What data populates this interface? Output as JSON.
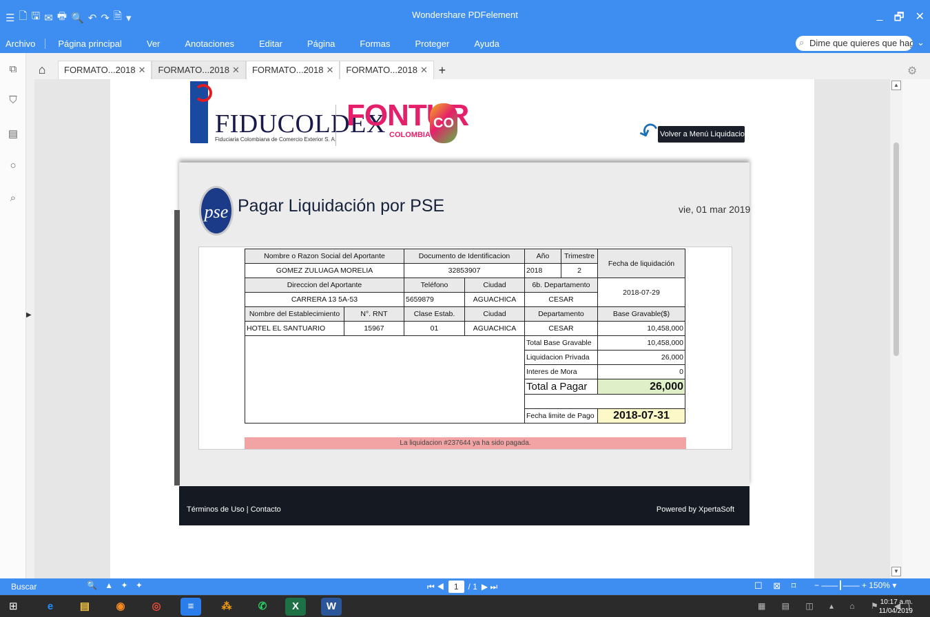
{
  "window": {
    "title": "Wondershare PDFelement",
    "quick_access": [
      "☰",
      "🗋",
      "🖫",
      "✉",
      "🖶",
      "🔍",
      "↶",
      "↷",
      "🗎",
      "▾"
    ],
    "controls": {
      "minimize": "_",
      "restore": "🗗",
      "close": "✕"
    }
  },
  "menu": {
    "items": [
      "Archivo",
      "Página principal",
      "Ver",
      "Anotaciones",
      "Editar",
      "Página",
      "Formas",
      "Proteger",
      "Ayuda"
    ],
    "search_placeholder": "Dime que quieres que hag",
    "search_icon": "⌕",
    "expand_icon": "⌄"
  },
  "tabs": [
    {
      "label": "FORMATO...2018",
      "close": "✕"
    },
    {
      "label": "FORMATO...2018",
      "close": "✕"
    },
    {
      "label": "FORMATO...2018",
      "close": "✕"
    },
    {
      "label": "FORMATO...2018",
      "close": "✕"
    }
  ],
  "tab_add": "+",
  "home_icon": "⌂",
  "document": {
    "fiduciaria_name": "FIDUCOLDEX",
    "fiduciaria_sub": "Fiduciaria Colombiana de Comercio Exterior S. A.",
    "fontur": "FONTUR",
    "fontur_country": "COLOMBIA",
    "fontur_badge": "CO",
    "back_button": "Volver a Menú Liquidaciones",
    "pse_logo": "pse",
    "pse_title": "Pagar Liquidación por PSE",
    "date": "vie, 01 mar 2019",
    "headers": {
      "razon_social": "Nombre o Razon Social del Aportante",
      "documento": "Documento de Identificacion",
      "anio": "Año",
      "trimestre": "Trimestre",
      "fecha_liq": "Fecha de liquidación",
      "direccion": "Direccion del Aportante",
      "telefono": "Teléfono",
      "ciudad": "Ciudad",
      "departamento_6b": "6b. Departamento",
      "establecimiento": "Nombre del Establecimiento",
      "rnt": "N°. RNT",
      "clase": "Clase Estab.",
      "ciudad2": "Ciudad",
      "departamento": "Departamento",
      "base": "Base Gravable($)"
    },
    "values": {
      "razon_social": "GOMEZ ZULUAGA MORELIA",
      "documento": "32853907",
      "anio": "2018",
      "trimestre": "2",
      "fecha_liq": "2018-07-29",
      "direccion": "CARRERA 13 5A-53",
      "telefono": "5659879",
      "ciudad": "AGUACHICA",
      "departamento_6b": "CESAR",
      "establecimiento": "HOTEL EL SANTUARIO",
      "rnt": "15967",
      "clase": "01",
      "ciudad2": "AGUACHICA",
      "departamento": "CESAR",
      "base": "10,458,000"
    },
    "summary": {
      "total_base_label": "Total Base Gravable",
      "total_base": "10,458,000",
      "liq_privada_label": "Liquidacion Privada",
      "liq_privada": "26,000",
      "mora_label": "Interes de Mora",
      "mora": "0",
      "total_label": "Total a Pagar",
      "total": "26,000",
      "limite_label": "Fecha limite de Pago",
      "limite": "2018-07-31"
    },
    "paid_message": "La liquidacion #237644 ya ha sido pagada.",
    "footer_left": "Términos de Uso | Contacto",
    "footer_right": "Powered by XpertaSoft"
  },
  "status": {
    "search": "Buscar",
    "search_nav": "🔍 ▲ ✦ ✦",
    "page_nav_left": "⏮ ◀",
    "page_current": "1",
    "page_total": "/ 1",
    "page_nav_right": "▶ ⏭",
    "views": "☐ ⊠ ⌑",
    "zoom": "150%",
    "zoom_minus": "−",
    "zoom_plus": "+"
  },
  "taskbar": {
    "time": "10:17 a.m.",
    "date": "11/04/2019",
    "apps": [
      {
        "name": "ie",
        "glyph": "e",
        "color": "#1e90ff"
      },
      {
        "name": "explorer",
        "glyph": "▤",
        "color": "#f5c542"
      },
      {
        "name": "firefox",
        "glyph": "◉",
        "color": "#f58a1f"
      },
      {
        "name": "chrome",
        "glyph": "◎",
        "color": "#e74c3c"
      },
      {
        "name": "docs",
        "glyph": "≡",
        "color": "#2b7de9"
      },
      {
        "name": "butterfly",
        "glyph": "⁂",
        "color": "#f39c12"
      },
      {
        "name": "whatsapp",
        "glyph": "✆",
        "color": "#25d366"
      },
      {
        "name": "excel",
        "glyph": "X",
        "color": "#1e7145"
      },
      {
        "name": "word",
        "glyph": "W",
        "color": "#2b579a"
      }
    ]
  },
  "colors": {
    "accent": "#3d8ef0",
    "footer": "#151a22",
    "paid": "#f2a3a3",
    "total": "#dff0c8",
    "limite": "#fdf8c8"
  }
}
